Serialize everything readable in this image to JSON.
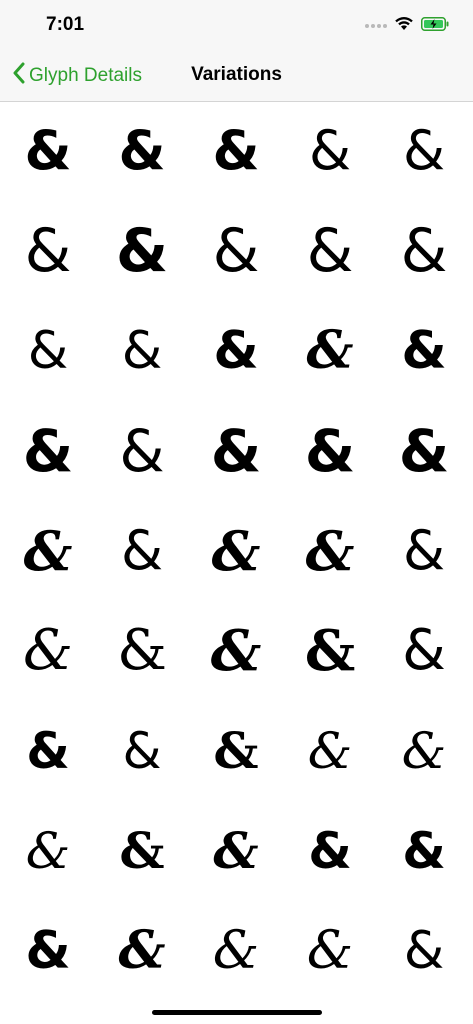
{
  "status_bar": {
    "time": "7:01"
  },
  "nav": {
    "back_label": "Glyph Details",
    "title": "Variations",
    "accent_color": "#2ea12e"
  },
  "glyph": "&",
  "variations": [
    {
      "font": "sans",
      "weight": "bold",
      "style": "normal"
    },
    {
      "font": "sans",
      "weight": "bold",
      "style": "normal"
    },
    {
      "font": "sans",
      "weight": "bold",
      "style": "normal"
    },
    {
      "font": "sans",
      "weight": "normal",
      "style": "normal"
    },
    {
      "font": "sans",
      "weight": "normal",
      "style": "normal"
    },
    {
      "font": "sans",
      "weight": "normal",
      "style": "normal"
    },
    {
      "font": "sans",
      "weight": "bold",
      "style": "normal"
    },
    {
      "font": "sans",
      "weight": "normal",
      "style": "normal"
    },
    {
      "font": "sans",
      "weight": "normal",
      "style": "normal"
    },
    {
      "font": "sans",
      "weight": "normal",
      "style": "normal"
    },
    {
      "font": "sans",
      "weight": "normal",
      "style": "normal"
    },
    {
      "font": "sans",
      "weight": "normal",
      "style": "normal"
    },
    {
      "font": "sans",
      "weight": "bold",
      "style": "normal"
    },
    {
      "font": "serif",
      "weight": "bold",
      "style": "italic"
    },
    {
      "font": "sans",
      "weight": "bold",
      "style": "normal"
    },
    {
      "font": "sans",
      "weight": "bold",
      "style": "normal"
    },
    {
      "font": "sans",
      "weight": "normal",
      "style": "normal"
    },
    {
      "font": "sans",
      "weight": "bold",
      "style": "normal"
    },
    {
      "font": "sans",
      "weight": "bold",
      "style": "normal"
    },
    {
      "font": "sans",
      "weight": "bold",
      "style": "normal"
    },
    {
      "font": "serif",
      "weight": "bold",
      "style": "italic"
    },
    {
      "font": "sans",
      "weight": "normal",
      "style": "normal"
    },
    {
      "font": "serif",
      "weight": "bold",
      "style": "italic"
    },
    {
      "font": "serif",
      "weight": "bold",
      "style": "italic"
    },
    {
      "font": "sans",
      "weight": "normal",
      "style": "normal"
    },
    {
      "font": "serif",
      "weight": "normal",
      "style": "italic"
    },
    {
      "font": "serif",
      "weight": "normal",
      "style": "normal"
    },
    {
      "font": "serif",
      "weight": "bold",
      "style": "italic"
    },
    {
      "font": "serif",
      "weight": "bold",
      "style": "normal"
    },
    {
      "font": "sans",
      "weight": "normal",
      "style": "normal"
    },
    {
      "font": "sans",
      "weight": "bold",
      "style": "normal"
    },
    {
      "font": "sans",
      "weight": "normal",
      "style": "normal"
    },
    {
      "font": "serif",
      "weight": "bold",
      "style": "normal"
    },
    {
      "font": "serif",
      "weight": "normal",
      "style": "italic"
    },
    {
      "font": "serif",
      "weight": "normal",
      "style": "italic"
    },
    {
      "font": "serif",
      "weight": "normal",
      "style": "italic"
    },
    {
      "font": "serif",
      "weight": "bold",
      "style": "normal"
    },
    {
      "font": "serif",
      "weight": "bold",
      "style": "italic"
    },
    {
      "font": "sans",
      "weight": "bold",
      "style": "normal"
    },
    {
      "font": "sans",
      "weight": "bold",
      "style": "normal"
    },
    {
      "font": "sans",
      "weight": "bold",
      "style": "normal"
    },
    {
      "font": "serif",
      "weight": "bold",
      "style": "italic"
    },
    {
      "font": "serif",
      "weight": "normal",
      "style": "italic"
    },
    {
      "font": "serif",
      "weight": "normal",
      "style": "italic"
    },
    {
      "font": "sans",
      "weight": "normal",
      "style": "normal"
    }
  ]
}
